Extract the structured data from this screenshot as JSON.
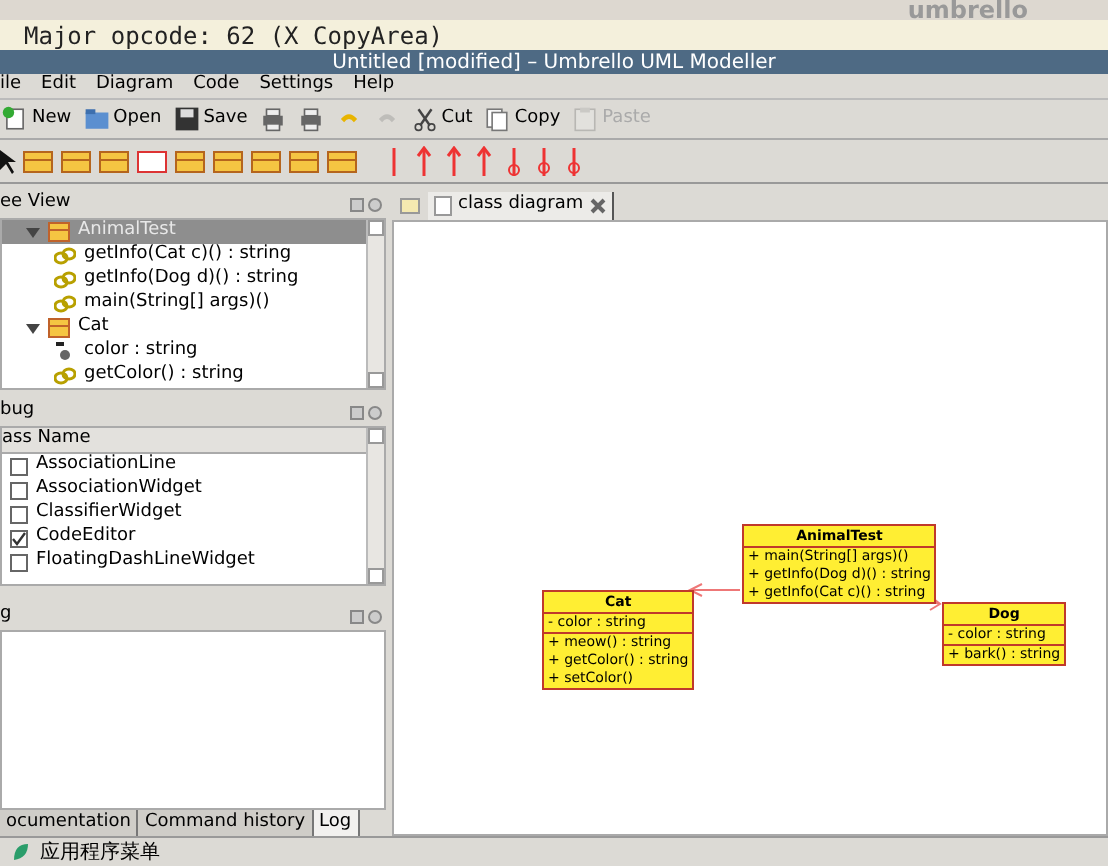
{
  "terminal": {
    "title": "umbrello",
    "text": "Major opcode: 62 (X CopyArea)"
  },
  "window": {
    "title": "Untitled [modified] – Umbrello UML Modeller"
  },
  "menu": [
    "ile",
    "Edit",
    "Diagram",
    "Code",
    "Settings",
    "Help"
  ],
  "toolbar": [
    {
      "label": "New",
      "disabled": false
    },
    {
      "label": "Open",
      "disabled": false
    },
    {
      "label": "Save",
      "disabled": false
    },
    {
      "disabled": false
    },
    {
      "disabled": false
    },
    {
      "disabled": false
    },
    {
      "disabled": true
    },
    {
      "label": "Cut",
      "disabled": false
    },
    {
      "label": "Copy",
      "disabled": false
    },
    {
      "label": "Paste",
      "disabled": true
    }
  ],
  "tree_view": {
    "title": "ee View",
    "items": [
      {
        "label": "AnimalTest",
        "kind": "class",
        "selected": true,
        "expanded": true,
        "children": [
          {
            "label": "getInfo(Cat c)() : string",
            "kind": "operation",
            "selected": false
          },
          {
            "label": "getInfo(Dog d)() : string",
            "kind": "operation",
            "selected": false
          },
          {
            "label": "main(String[] args)()",
            "kind": "operation",
            "selected": false
          }
        ]
      },
      {
        "label": "Cat",
        "kind": "class",
        "selected": false,
        "expanded": true,
        "children": [
          {
            "label": "color : string",
            "kind": "attribute",
            "selected": false
          },
          {
            "label": "getColor() : string",
            "kind": "operation",
            "selected": false
          }
        ]
      }
    ]
  },
  "debug": {
    "title": "bug",
    "column": "ass Name",
    "rows": [
      {
        "label": "AssociationLine",
        "checked": false
      },
      {
        "label": "AssociationWidget",
        "checked": false
      },
      {
        "label": "ClassifierWidget",
        "checked": false
      },
      {
        "label": "CodeEditor",
        "checked": true
      },
      {
        "label": "FloatingDashLineWidget",
        "checked": false
      }
    ]
  },
  "log": {
    "title": "g"
  },
  "diagram_tab": {
    "label": "class diagram"
  },
  "classes": [
    {
      "name": "AnimalTest",
      "operations": [
        "+ main(String[] args)()",
        "+ getInfo(Dog d)() : string",
        "+ getInfo(Cat c)() : string"
      ]
    },
    {
      "name": "Cat",
      "attributes": [
        "- color : string"
      ],
      "operations": [
        "+ meow() : string",
        "+ getColor() : string",
        "+ setColor()"
      ]
    },
    {
      "name": "Dog",
      "attributes": [
        "- color : string"
      ],
      "operations": [
        "+ bark() : string"
      ]
    }
  ],
  "bottom_tabs": [
    {
      "label": "ocumentation",
      "selected": false
    },
    {
      "label": "Command history",
      "selected": false
    },
    {
      "label": "Log",
      "selected": true
    }
  ],
  "taskbar": {
    "label": "应用程序菜单"
  }
}
